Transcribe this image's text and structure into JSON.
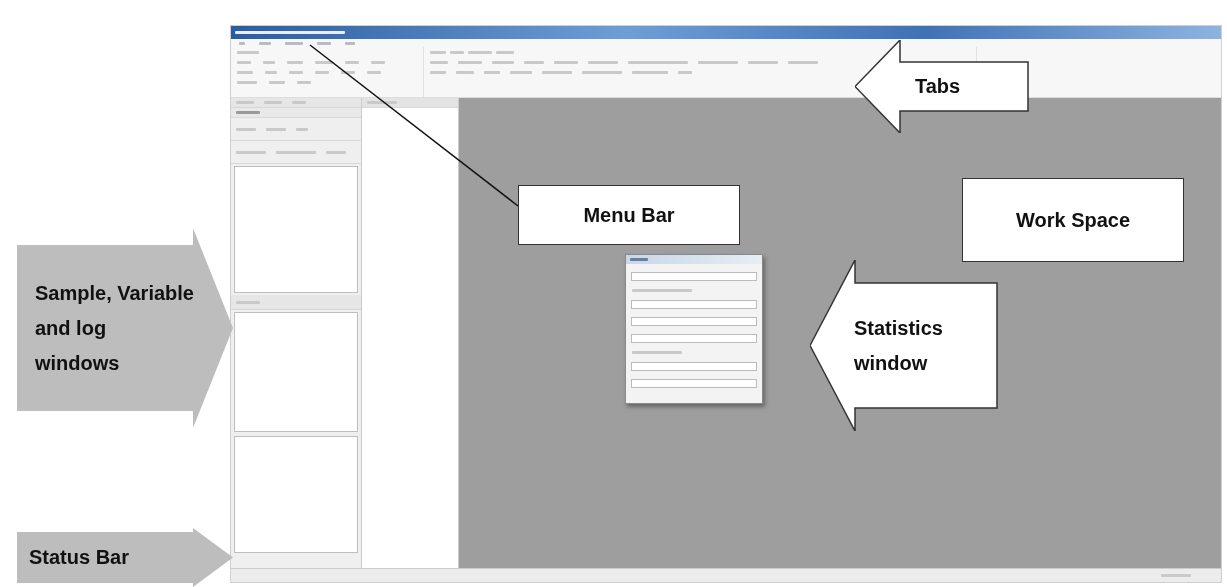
{
  "callouts": [
    {
      "kind": "arrow-left",
      "label": "Tabs"
    },
    {
      "kind": "box",
      "label": "Menu Bar"
    },
    {
      "kind": "box",
      "label": "Work Space"
    },
    {
      "kind": "arrow-right",
      "label": "Sample, Variable and log windows"
    },
    {
      "kind": "arrow-left",
      "label": "Statistics window"
    },
    {
      "kind": "arrow-right",
      "label": "Status Bar"
    }
  ]
}
